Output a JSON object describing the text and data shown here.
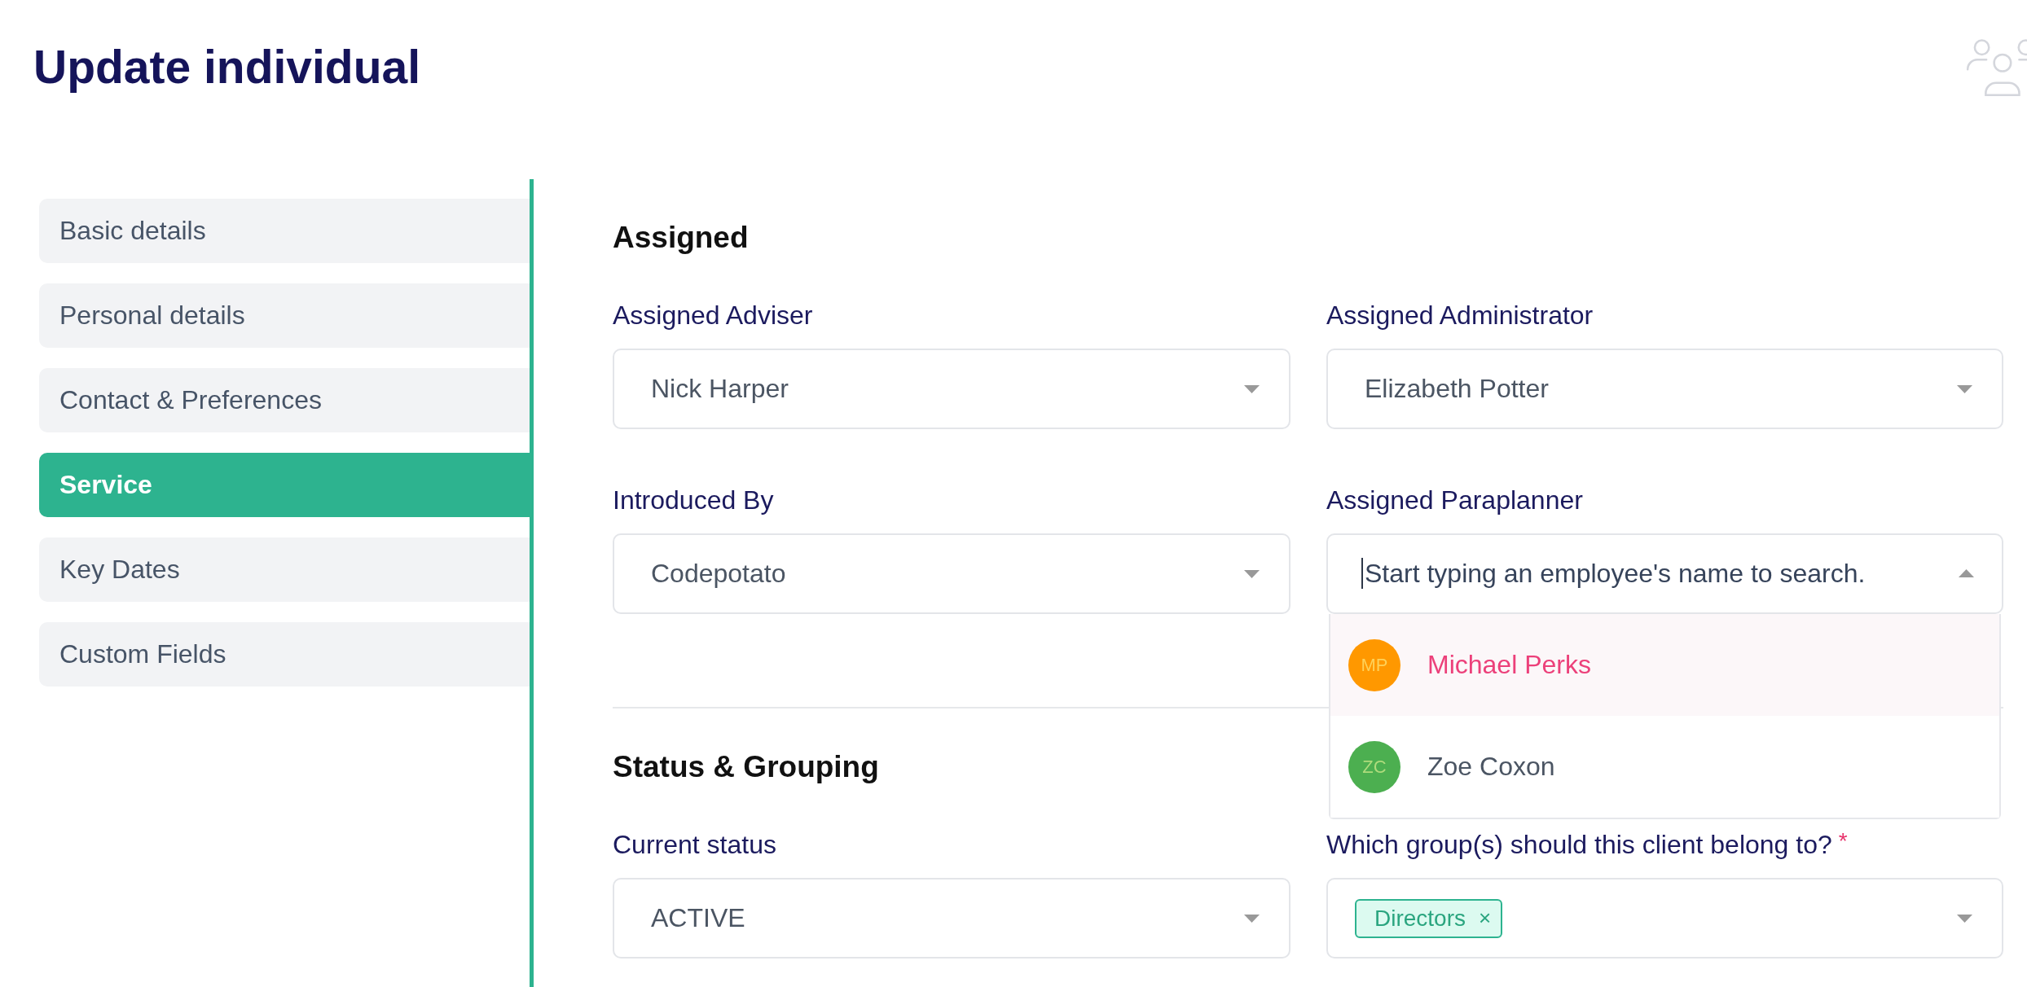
{
  "header": {
    "title": "Update individual"
  },
  "sidebar": {
    "items": [
      {
        "label": "Basic details",
        "selected": false
      },
      {
        "label": "Personal details",
        "selected": false
      },
      {
        "label": "Contact & Preferences",
        "selected": false
      },
      {
        "label": "Service",
        "selected": true
      },
      {
        "label": "Key Dates",
        "selected": false
      },
      {
        "label": "Custom Fields",
        "selected": false
      }
    ]
  },
  "sections": [
    {
      "title": "Assigned",
      "fields": [
        {
          "kind": "select",
          "label": "Assigned Adviser",
          "value": "Nick Harper",
          "expanded": false
        },
        {
          "kind": "select",
          "label": "Assigned Administrator",
          "value": "Elizabeth Potter",
          "expanded": false
        },
        {
          "kind": "select",
          "label": "Introduced By",
          "value": "Codepotato",
          "expanded": false
        },
        {
          "kind": "search",
          "label": "Assigned Paraplanner",
          "placeholder": "Start typing an employee's name to search.",
          "expanded": true,
          "options": [
            {
              "initials": "MP",
              "name": "Michael Perks",
              "color": "#ff9800",
              "highlighted": true
            },
            {
              "initials": "ZC",
              "name": "Zoe Coxon",
              "color": "#4caf50",
              "highlighted": false
            }
          ]
        }
      ]
    },
    {
      "title": "Status & Grouping",
      "fields": [
        {
          "kind": "select",
          "label": "Current status",
          "value": "ACTIVE",
          "expanded": false
        },
        {
          "kind": "tags",
          "label": "Which group(s) should this client belong to?",
          "required_mark": "*",
          "expanded": false,
          "tags": [
            {
              "label": "Directors",
              "remove": "×"
            }
          ]
        }
      ]
    }
  ]
}
